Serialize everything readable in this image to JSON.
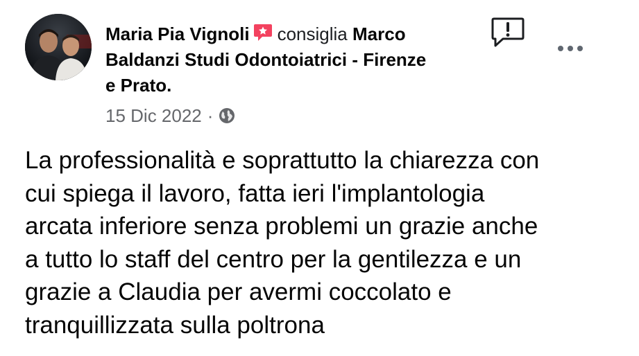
{
  "post": {
    "author": "Maria Pia Vignoli",
    "verb": "consiglia",
    "page_line1": "Marco",
    "page_line2": "Baldanzi Studi Odontoiatrici - Firenze",
    "page_line3": "e Prato.",
    "date": "15 Dic 2022",
    "separator": "·",
    "audience_icon": "globe-icon",
    "recommend_icon": "recommendation-badge-icon",
    "report_icon": "report-flag-icon",
    "more_icon": "more-options-icon",
    "body_lines": [
      "La professionalità e soprattutto la chiarezza con",
      "cui spiega il lavoro, fatta ieri l'implantologia",
      "arcata inferiore senza problemi un grazie anche",
      "a tutto lo staff del centro per la gentilezza e un",
      "grazie a Claudia per avermi coccolato e",
      "tranquillizzata sulla poltrona"
    ]
  },
  "colors": {
    "text": "#050505",
    "secondary": "#65676b",
    "recommend_badge": "#f3425f",
    "icon": "#1c1e21"
  }
}
